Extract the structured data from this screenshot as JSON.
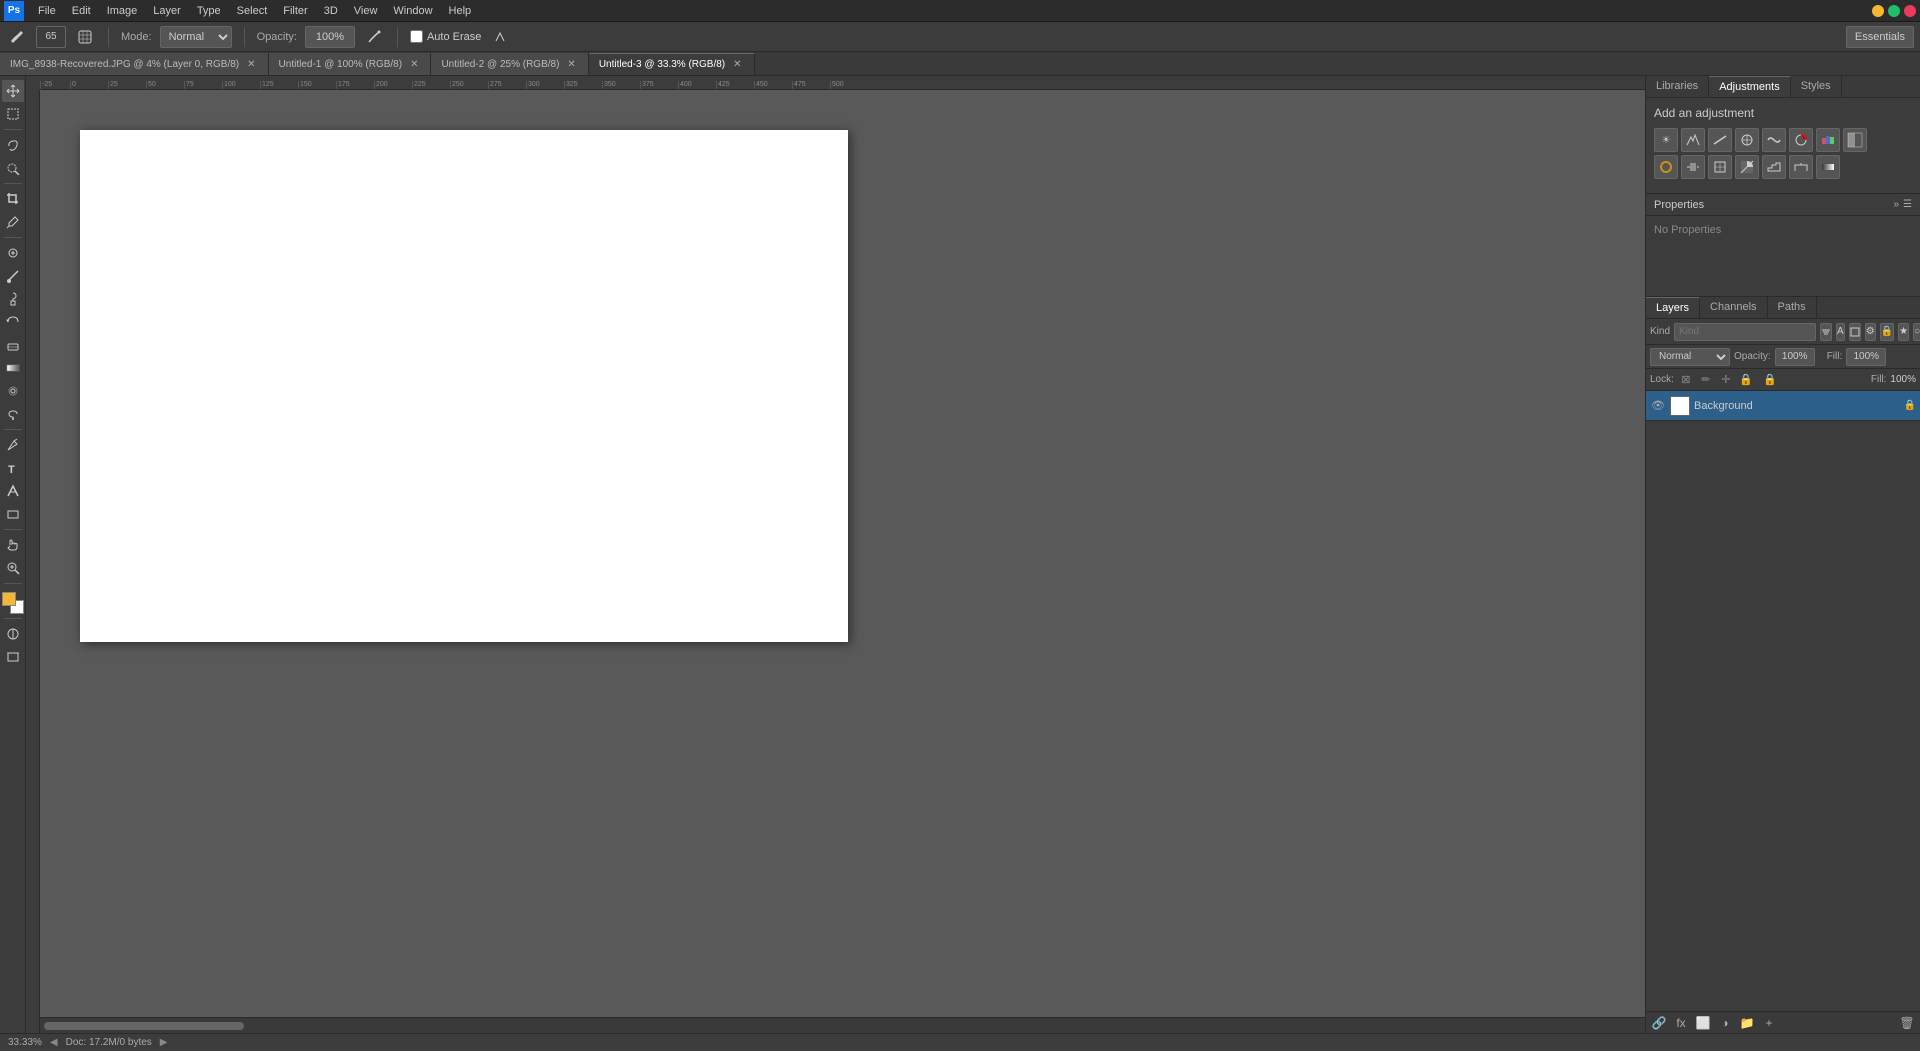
{
  "menubar": {
    "logo": "Ps",
    "items": [
      "File",
      "Edit",
      "Image",
      "Layer",
      "Type",
      "Select",
      "Filter",
      "3D",
      "View",
      "Window",
      "Help"
    ]
  },
  "optionsbar": {
    "mode_label": "Mode:",
    "mode_value": "Normal",
    "opacity_label": "Opacity:",
    "opacity_value": "100%",
    "auto_erase_label": "Auto Erase",
    "essentials_label": "Essentials"
  },
  "tabs": [
    {
      "label": "IMG_8938-Recovered.JPG @ 4% (Layer 0, RGB/8)",
      "active": false,
      "closeable": true
    },
    {
      "label": "Untitled-1 @ 100% (RGB/8)",
      "active": false,
      "closeable": true
    },
    {
      "label": "Untitled-2 @ 25% (RGB/8)",
      "active": false,
      "closeable": true
    },
    {
      "label": "Untitled-3 @ 33.3% (RGB/8)",
      "active": true,
      "closeable": true
    }
  ],
  "properties_panel": {
    "title": "Properties",
    "no_properties_text": "No Properties",
    "action_btn": "Add an adjustment"
  },
  "adjustments_panel": {
    "tabs": [
      "Libraries",
      "Adjustments",
      "Styles"
    ],
    "active_tab": "Adjustments",
    "title": "Add an adjustment",
    "icons": [
      "☀",
      "▩",
      "◑",
      "⊙",
      "⊞",
      "⊟",
      "⊠",
      "⊡",
      "▤",
      "▦",
      "▧",
      "▨",
      "▩",
      "◰",
      "◱",
      "◲"
    ]
  },
  "layers_panel": {
    "tabs": [
      "Layers",
      "Channels",
      "Paths"
    ],
    "active_tab": "Layers",
    "kind_placeholder": "Kind",
    "blend_mode": "Normal",
    "opacity_label": "Opacity:",
    "opacity_value": "100%",
    "fill_label": "Fill:",
    "fill_value": "100%",
    "lock_label": "Lock:",
    "layers": [
      {
        "name": "Background",
        "visible": true,
        "locked": true,
        "selected": true
      }
    ]
  },
  "statusbar": {
    "zoom": "33.33%",
    "doc_info": "Doc: 17.2M/0 bytes"
  }
}
